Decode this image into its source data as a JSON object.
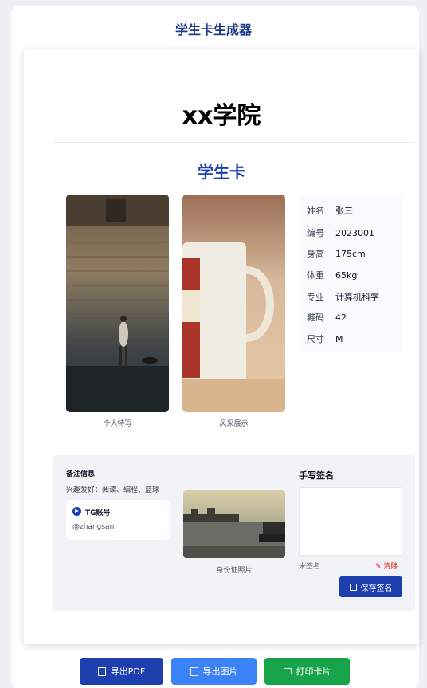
{
  "app": {
    "title": "学生卡生成器"
  },
  "card": {
    "school": "xx学院",
    "title": "学生卡",
    "photos": {
      "portrait_caption": "个人特写",
      "scenery_caption": "风采展示"
    },
    "info": [
      {
        "label": "姓名",
        "value": "张三"
      },
      {
        "label": "编号",
        "value": "2023001"
      },
      {
        "label": "身高",
        "value": "175cm"
      },
      {
        "label": "体重",
        "value": "65kg"
      },
      {
        "label": "专业",
        "value": "计算机科学"
      },
      {
        "label": "鞋码",
        "value": "42"
      },
      {
        "label": "尺寸",
        "value": "M"
      }
    ],
    "remarks": {
      "title": "备注信息",
      "hobbies": "兴趣爱好：阅读、编程、篮球",
      "tg_label": "TG账号",
      "tg_handle": "@zhangsan"
    },
    "id_photo_caption": "身份证照片",
    "signature": {
      "title": "手写签名",
      "status": "未签名",
      "clear_label": "清除",
      "save_label": "保存签名"
    }
  },
  "actions": {
    "export_pdf": "导出PDF",
    "export_image": "导出图片",
    "print_card": "打印卡片"
  },
  "colors": {
    "primary": "#1e40af",
    "image_button": "#3b82f6",
    "print_button": "#16a34a",
    "danger": "#dc2626"
  }
}
